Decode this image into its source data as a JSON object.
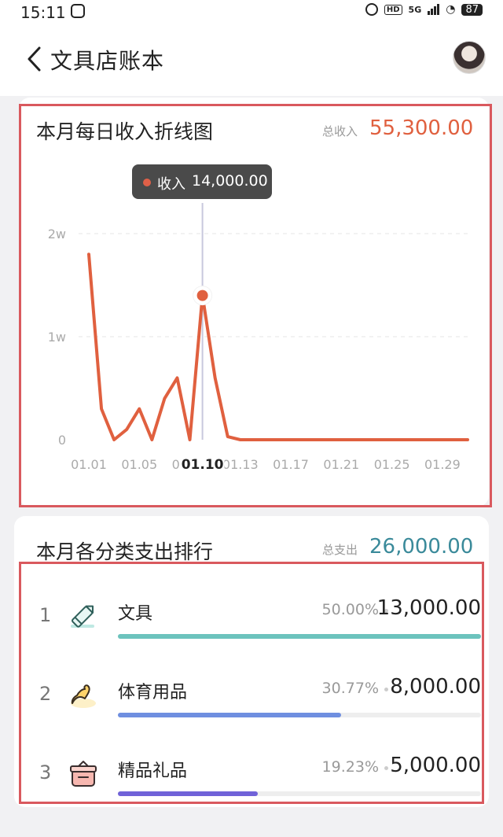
{
  "status_bar": {
    "time": "15:11",
    "network": "5G",
    "hd": "HD",
    "battery": "87"
  },
  "header": {
    "title": "文具店账本"
  },
  "income_card": {
    "title": "本月每日收入折线图",
    "total_label": "总收入",
    "total_value": "55,300.00",
    "total_color": "#e0603f",
    "tooltip": {
      "series": "收入",
      "value": "14,000.00",
      "date": "01.10"
    }
  },
  "chart_data": {
    "type": "line",
    "title": "本月每日收入折线图",
    "x_tick_labels": [
      "01.01",
      "01.05",
      "01.09",
      "01.13",
      "01.17",
      "01.21",
      "01.25",
      "01.29"
    ],
    "y_tick_labels": [
      "0",
      "1w",
      "2w"
    ],
    "ylim": [
      0,
      20000
    ],
    "xlim": [
      1,
      31
    ],
    "grid": true,
    "highlighted_point": {
      "day": 10,
      "value": 14000
    },
    "series": [
      {
        "name": "收入",
        "color": "#e0603f",
        "x": [
          1,
          2,
          3,
          4,
          5,
          6,
          7,
          8,
          9,
          10,
          11,
          12,
          13,
          14,
          15,
          16,
          17,
          18,
          19,
          20,
          21,
          22,
          23,
          24,
          25,
          26,
          27,
          28,
          29,
          30,
          31
        ],
        "y": [
          18000,
          3000,
          0,
          1000,
          3000,
          0,
          4000,
          6000,
          0,
          14000,
          6000,
          300,
          0,
          0,
          0,
          0,
          0,
          0,
          0,
          0,
          0,
          0,
          0,
          0,
          0,
          0,
          0,
          0,
          0,
          0,
          0
        ]
      }
    ]
  },
  "expense_card": {
    "title": "本月各分类支出排行",
    "total_label": "总支出",
    "total_value": "26,000.00",
    "total_color": "#3a8a9a",
    "items": [
      {
        "rank": "1",
        "name": "文具",
        "percent": "50.00%",
        "amount": "13,000.00",
        "fraction": 0.5,
        "bar_fraction": 1.0,
        "color": "#6cc3bd",
        "icon": "pencil-icon"
      },
      {
        "rank": "2",
        "name": "体育用品",
        "percent": "30.77%",
        "amount": "8,000.00",
        "fraction": 0.3077,
        "bar_fraction": 0.615,
        "color": "#6f8fe0",
        "icon": "flexed-arm-icon"
      },
      {
        "rank": "3",
        "name": "精品礼品",
        "percent": "19.23%",
        "amount": "5,000.00",
        "fraction": 0.1923,
        "bar_fraction": 0.385,
        "color": "#7062d8",
        "icon": "gift-box-icon"
      }
    ]
  }
}
